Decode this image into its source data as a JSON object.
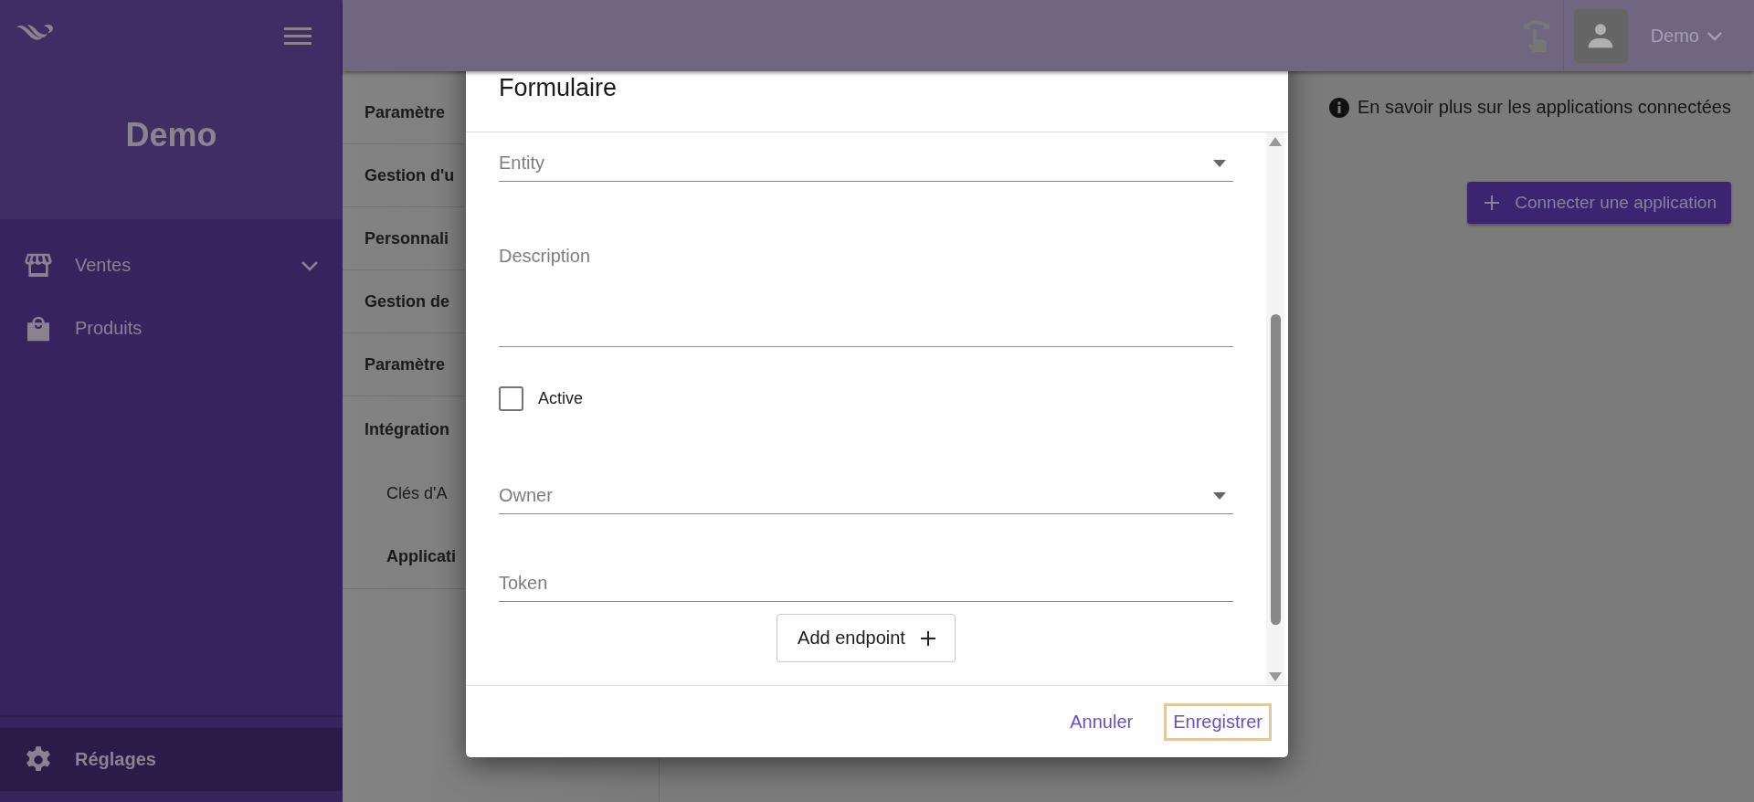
{
  "sidebar": {
    "brand": "Demo",
    "items": [
      {
        "label": "Ventes",
        "has_submenu": true,
        "selected": false
      },
      {
        "label": "Produits",
        "has_submenu": false,
        "selected": false
      }
    ],
    "footer_item": {
      "label": "Réglages",
      "selected": true
    }
  },
  "topbar": {
    "user": "Demo"
  },
  "settings_menu": {
    "items": [
      {
        "label": "Paramètre",
        "selected": false
      },
      {
        "label": "Gestion d'u",
        "selected": false
      },
      {
        "label": "Personnali",
        "selected": false
      },
      {
        "label": "Gestion de",
        "selected": false
      },
      {
        "label": "Paramètre",
        "selected": false
      },
      {
        "label": "Intégration",
        "selected": false,
        "children": [
          {
            "label": "Clés d'A",
            "selected": false
          },
          {
            "label": "Applicati",
            "selected": true
          }
        ]
      }
    ]
  },
  "main": {
    "info_link": "En savoir plus sur les applications connectées",
    "connect_button": "Connecter une application"
  },
  "dialog": {
    "title": "Formulaire",
    "fields": [
      {
        "kind": "select",
        "placeholder": "Entity"
      },
      {
        "kind": "textarea",
        "placeholder": "Description"
      },
      {
        "kind": "checkbox",
        "label": "Active",
        "checked": false
      },
      {
        "kind": "select",
        "placeholder": "Owner"
      },
      {
        "kind": "text",
        "placeholder": "Token"
      }
    ],
    "add_button": "Add endpoint",
    "actions": [
      {
        "label": "Annuler",
        "focused": false
      },
      {
        "label": "Enregistrer",
        "focused": true
      }
    ]
  }
}
